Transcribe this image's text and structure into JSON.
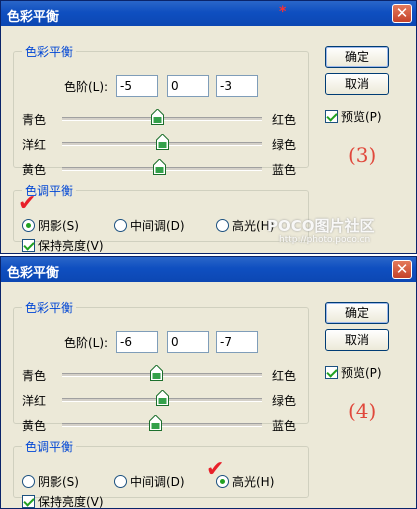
{
  "dialogs": [
    {
      "title": "色彩平衡",
      "close_glyph": "✕",
      "balance": {
        "legend": "色彩平衡",
        "levels_label": "色阶(L):",
        "levels": [
          "-5",
          "0",
          "-3"
        ],
        "sliders": [
          {
            "left": "青色",
            "right": "红色",
            "value": -5
          },
          {
            "left": "洋红",
            "right": "绿色",
            "value": 0
          },
          {
            "left": "黄色",
            "right": "蓝色",
            "value": -3
          }
        ]
      },
      "tone": {
        "legend": "色调平衡",
        "options": [
          "阴影(S)",
          "中间调(D)",
          "高光(H)"
        ],
        "selected": "阴影(S)",
        "preserve_label": "保持亮度(V)",
        "preserve_checked": true
      },
      "buttons": {
        "ok": "确定",
        "cancel": "取消"
      },
      "preview_label": "预览(P)",
      "preview_checked": true,
      "stage_label": "(3)"
    },
    {
      "title": "色彩平衡",
      "close_glyph": "✕",
      "balance": {
        "legend": "色彩平衡",
        "levels_label": "色阶(L):",
        "levels": [
          "-6",
          "0",
          "-7"
        ],
        "sliders": [
          {
            "left": "青色",
            "right": "红色",
            "value": -6
          },
          {
            "left": "洋红",
            "right": "绿色",
            "value": 0
          },
          {
            "left": "黄色",
            "right": "蓝色",
            "value": -7
          }
        ]
      },
      "tone": {
        "legend": "色调平衡",
        "options": [
          "阴影(S)",
          "中间调(D)",
          "高光(H)"
        ],
        "selected": "高光(H)",
        "preserve_label": "保持亮度(V)",
        "preserve_checked": true
      },
      "buttons": {
        "ok": "确定",
        "cancel": "取消"
      },
      "preview_label": "预览(P)",
      "preview_checked": true,
      "stage_label": "(4)"
    }
  ],
  "watermark": {
    "brand": "POCO图片社区",
    "url": "http://photo.poco.cn"
  },
  "colors": {
    "titlebar": "#0c47b3",
    "legend": "#0046d5",
    "dialog_bg": "#ece9d8",
    "annotation": "#e0483b"
  }
}
